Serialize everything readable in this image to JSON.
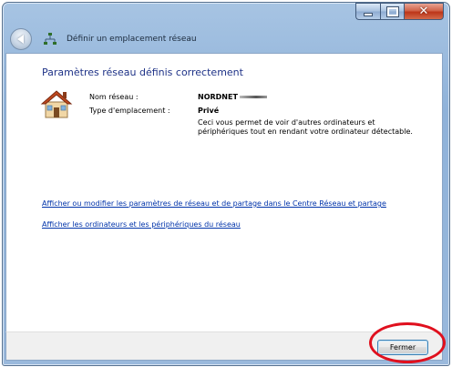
{
  "window": {
    "title": "Définir un emplacement réseau"
  },
  "content": {
    "heading": "Paramètres réseau définis correctement",
    "network_name_label": "Nom réseau :",
    "network_name_value": "NORDNET",
    "location_type_label": "Type d'emplacement :",
    "location_type_value": "Privé",
    "description": "Ceci vous permet de voir d'autres ordinateurs et périphériques tout en rendant votre ordinateur détectable.",
    "links": [
      "Afficher ou modifier les paramètres de réseau et de partage dans le Centre Réseau et partage",
      "Afficher les ordinateurs et les périphériques du réseau"
    ]
  },
  "footer": {
    "close_button_label": "Fermer"
  },
  "icons": {
    "window_controls": [
      "minimize-icon",
      "maximize-icon",
      "close-icon"
    ],
    "back": "back-arrow-icon",
    "network": "network-icon",
    "location": "house-icon"
  },
  "colors": {
    "heading": "#1e3287",
    "link": "#0033aa",
    "highlight": "#e0101e"
  }
}
